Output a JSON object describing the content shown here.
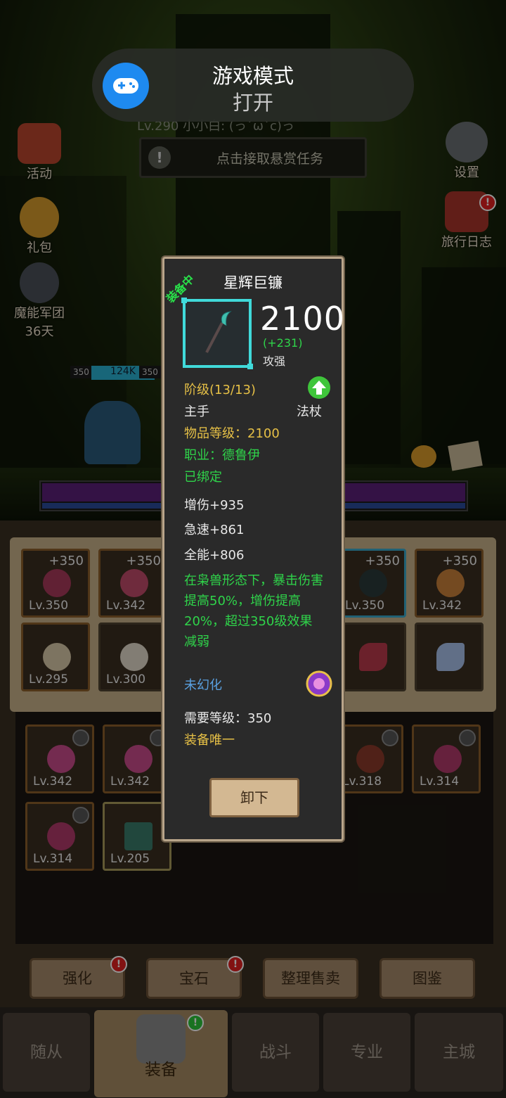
{
  "toast": {
    "title": "游戏模式",
    "subtitle": "打开",
    "icon": "gamepad-icon",
    "accent": "#1e8af0"
  },
  "header": {
    "player_info": "Lv.290 小小白: (っ´ω`c)っ",
    "quest_button": "点击接取悬赏任务"
  },
  "side_left": [
    {
      "label": "活动",
      "icon": "calendar-icon"
    },
    {
      "label": "礼包",
      "icon": "gift-icon"
    },
    {
      "label": "魔能军团",
      "icon": "legion-icon"
    },
    {
      "label": "36天",
      "icon": ""
    }
  ],
  "side_right": [
    {
      "label": "设置",
      "icon": "gear-icon"
    },
    {
      "label": "旅行日志",
      "icon": "journal-icon",
      "badge": "!"
    }
  ],
  "battle": {
    "hp_left": "350",
    "power": "124K",
    "hp_right": "350"
  },
  "equipment_slots": [
    {
      "plus": "+350",
      "level": "Lv.350",
      "style": "orange"
    },
    {
      "plus": "+350",
      "level": "Lv.342",
      "style": "orange"
    },
    {
      "plus": "+350",
      "level": "Lv.350",
      "style": "blue"
    },
    {
      "plus": "+350",
      "level": "Lv.342",
      "style": "orange"
    },
    {
      "plus": "",
      "level": "Lv.295",
      "style": "orange"
    },
    {
      "plus": "",
      "level": "Lv.300",
      "style": "dark"
    },
    {
      "plus": "",
      "level": "",
      "style": "dark"
    },
    {
      "plus": "",
      "level": "",
      "style": "dark"
    }
  ],
  "inventory": [
    {
      "level": "Lv.342"
    },
    {
      "level": "Lv.342"
    },
    {
      "level": "Lv.318"
    },
    {
      "level": "Lv.314"
    },
    {
      "level": "Lv.314"
    },
    {
      "level": "Lv.205"
    }
  ],
  "toolbar": {
    "enhance": "强化",
    "gem": "宝石",
    "sort_sell": "整理售卖",
    "codex": "图鉴"
  },
  "nav": {
    "followers": "随从",
    "equipment": "装备",
    "battle": "战斗",
    "profession": "专业",
    "main_city": "主城"
  },
  "item": {
    "equipped_tag": "装备中",
    "name": "星辉巨镰",
    "power": "2100",
    "power_delta": "(+231)",
    "power_rank": "攻强",
    "tier": "阶级(13/13)",
    "slot": "主手",
    "weapon_type": "法杖",
    "item_level": "物品等级：2100",
    "class_req": "职业：德鲁伊",
    "bound": "已绑定",
    "stats": [
      "增伤+935",
      "急速+861",
      "全能+806"
    ],
    "effect": "在枭兽形态下，暴击伤害提高50%，增伤提高20%，超过350级效果减弱",
    "transmog": "未幻化",
    "req_level": "需要等级：350",
    "unique": "装备唯一",
    "unequip_button": "卸下"
  },
  "colors": {
    "frame_gold": "#b9a58a",
    "rare_cyan": "#40dada",
    "stat_green": "#2fd44a",
    "stat_gold": "#e6c046",
    "transmog_blue": "#5aa0e0"
  }
}
